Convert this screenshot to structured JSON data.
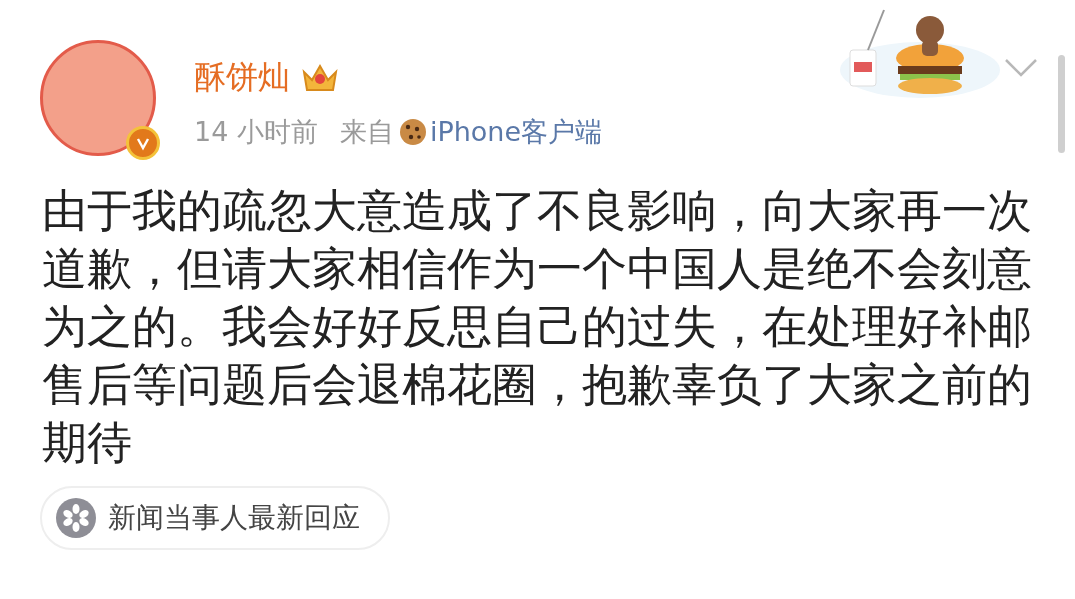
{
  "post": {
    "author": "酥饼灿",
    "verified": true,
    "time": "14 小时前",
    "source_prefix": "来自",
    "source": "iPhone客户端",
    "body": "由于我的疏忽大意造成了不良影响，向大家再一次道歉，但请大家相信作为一个中国人是绝不会刻意为之的。我会好好反思自己的过失，在处理好补邮售后等问题后会退棉花圈，抱歉辜负了大家之前的期待",
    "topic": "新闻当事人最新回应"
  }
}
